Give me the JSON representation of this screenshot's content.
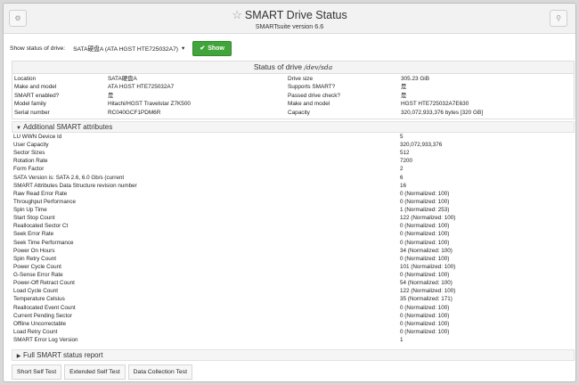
{
  "header": {
    "settings_icon": "gear-icon",
    "search_icon": "search-icon",
    "title_icon": "star-icon",
    "title": "SMART Drive Status",
    "subtitle": "SMARTsuite version 6.6"
  },
  "drive_select": {
    "label": "Show status of drive:",
    "selected": "SATA硬盘A (ATA HGST HTE725032A7)",
    "show_button": "Show"
  },
  "status": {
    "heading": "Status of drive",
    "device": "/dev/sda",
    "rows": [
      {
        "l1": "Location",
        "v1": "SATA硬盘A",
        "l2": "Drive size",
        "v2": "305.23 GiB"
      },
      {
        "l1": "Make and model",
        "v1": "ATA HGST HTE725032A7",
        "l2": "Supports SMART?",
        "v2": "是"
      },
      {
        "l1": "SMART enabled?",
        "v1": "是",
        "l2": "Passed drive check?",
        "v2": "是"
      },
      {
        "l1": "Model family",
        "v1": "Hitachi/HGST Travelstar Z7K500",
        "l2": "Make and model",
        "v2": "HGST HTE725032A7E630"
      },
      {
        "l1": "Serial number",
        "v1": "RC040GCF1PDM6R",
        "l2": "Capacity",
        "v2": "320,072,933,376 bytes [320 GB]"
      }
    ]
  },
  "additional": {
    "heading": "Additional SMART attributes",
    "attributes": [
      {
        "name": "LU WWN Device Id",
        "value": "5"
      },
      {
        "name": "User Capacity",
        "value": "320,072,933,376"
      },
      {
        "name": "Sector Sizes",
        "value": "512"
      },
      {
        "name": "Rotation Rate",
        "value": "7200"
      },
      {
        "name": "Form Factor",
        "value": "2"
      },
      {
        "name": "SATA Version is: SATA 2.6, 6.0 Gb/s (current",
        "value": "6"
      },
      {
        "name": "SMART Attributes Data Structure revision number",
        "value": "16"
      },
      {
        "name": "Raw Read Error Rate",
        "value": "0 (Normalized: 100)"
      },
      {
        "name": "Throughput Performance",
        "value": "0 (Normalized: 100)"
      },
      {
        "name": "Spin Up Time",
        "value": "1 (Normalized: 253)"
      },
      {
        "name": "Start Stop Count",
        "value": "122 (Normalized: 100)"
      },
      {
        "name": "Reallocated Sector Ct",
        "value": "0 (Normalized: 100)"
      },
      {
        "name": "Seek Error Rate",
        "value": "0 (Normalized: 100)"
      },
      {
        "name": "Seek Time Performance",
        "value": "0 (Normalized: 100)"
      },
      {
        "name": "Power On Hours",
        "value": "34 (Normalized: 100)"
      },
      {
        "name": "Spin Retry Count",
        "value": "0 (Normalized: 100)"
      },
      {
        "name": "Power Cycle Count",
        "value": "101 (Normalized: 100)"
      },
      {
        "name": "G-Sense Error Rate",
        "value": "0 (Normalized: 100)"
      },
      {
        "name": "Power-Off Retract Count",
        "value": "54 (Normalized: 100)"
      },
      {
        "name": "Load Cycle Count",
        "value": "122 (Normalized: 100)"
      },
      {
        "name": "Temperature Celsius",
        "value": "35 (Normalized: 171)"
      },
      {
        "name": "Reallocated Event Count",
        "value": "0 (Normalized: 100)"
      },
      {
        "name": "Current Pending Sector",
        "value": "0 (Normalized: 100)"
      },
      {
        "name": "Offline Uncorrectable",
        "value": "0 (Normalized: 100)"
      },
      {
        "name": "Load Retry Count",
        "value": "0 (Normalized: 100)"
      },
      {
        "name": "SMART Error Log Version",
        "value": "1"
      }
    ]
  },
  "full_report": {
    "heading": "Full SMART status report"
  },
  "tests": {
    "short": "Short Self Test",
    "extended": "Extended Self Test",
    "data_collection": "Data Collection Test"
  },
  "colors": {
    "accent": "#42a53b",
    "panel": "#f4f4f4",
    "border": "#dddddd"
  }
}
